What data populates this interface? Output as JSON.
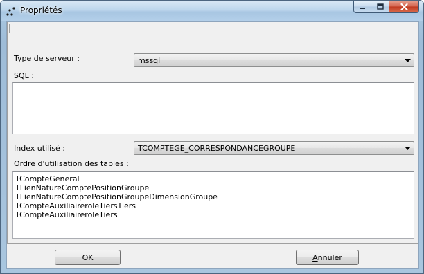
{
  "window": {
    "title": "Propriétés"
  },
  "form": {
    "server_type_label": "Type de serveur :",
    "server_type_value": "mssql",
    "sql_label": "SQL :",
    "sql_value": "",
    "index_label": "Index utilisé :",
    "index_value": "TCOMPTEGE_CORRESPONDANCEGROUPE",
    "tables_order_label": "Ordre d'utilisation des tables :",
    "tables_order": [
      "TCompteGeneral",
      "TLienNatureComptePositionGroupe",
      "TLienNatureComptePositionGroupeDimensionGroupe",
      "TCompteAuxiliaireroleTiersTiers",
      "TCompteAuxiliaireroleTiers"
    ]
  },
  "buttons": {
    "ok_label": "OK",
    "cancel_first_letter": "A",
    "cancel_rest": "nnuler"
  },
  "icons": {
    "app": "app-dots-icon",
    "minimize": "minimize-icon",
    "maximize": "maximize-icon",
    "close": "close-icon",
    "dropdown": "chevron-down-icon"
  }
}
